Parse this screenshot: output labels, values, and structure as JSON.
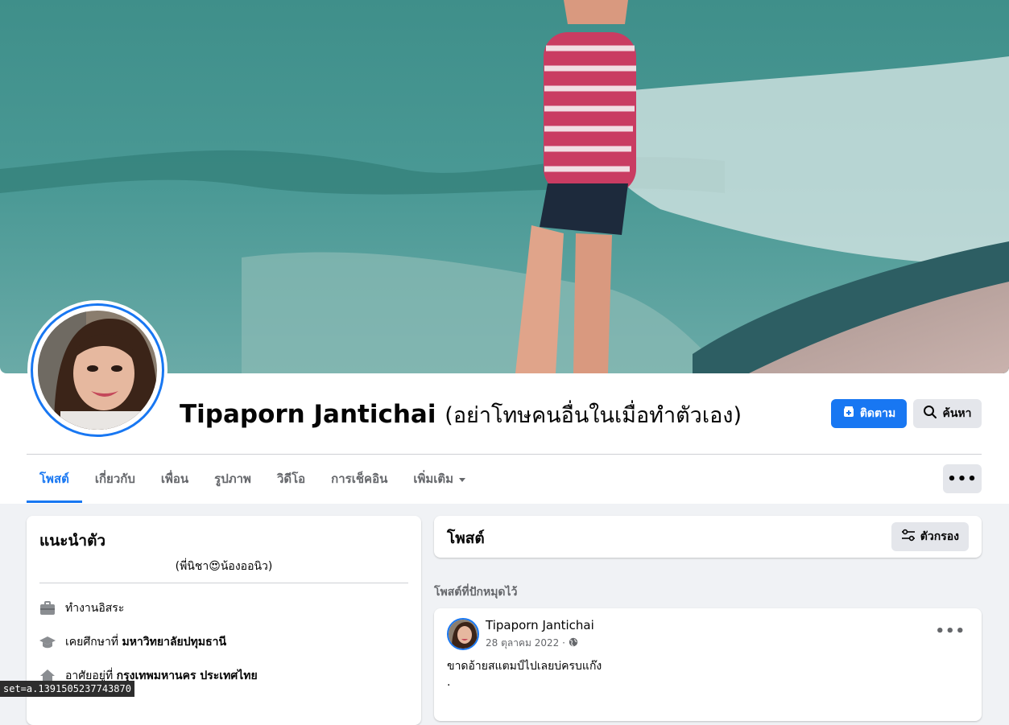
{
  "profile": {
    "name": "Tipaporn Jantichai",
    "alternate_name": "(อย่าโทษคนอื่นในเมื่อทำตัวเอง)"
  },
  "actions": {
    "follow_label": "ติดตาม",
    "search_label": "ค้นหา",
    "more_label": "•••"
  },
  "tabs": [
    {
      "label": "โพสต์"
    },
    {
      "label": "เกี่ยวกับ"
    },
    {
      "label": "เพื่อน"
    },
    {
      "label": "รูปภาพ"
    },
    {
      "label": "วิดีโอ"
    },
    {
      "label": "การเช็คอิน"
    },
    {
      "label": "เพิ่มเติม"
    }
  ],
  "intro": {
    "title": "แนะนำตัว",
    "bio_prefix": "(พี่นิชา",
    "bio_emoji": "😍",
    "bio_suffix": "น้องออนิว)",
    "rows": [
      {
        "icon": "briefcase-icon",
        "text": "ทำงานอิสระ",
        "bold": ""
      },
      {
        "icon": "graduation-cap-icon",
        "text": "เคยศึกษาที่ ",
        "bold": "มหาวิทยาลัยปทุมธานี"
      },
      {
        "icon": "home-icon",
        "text": "อาศัยอยู่ที่ ",
        "bold": "กรุงเทพมหานคร ประเทศไทย"
      }
    ]
  },
  "posts": {
    "title": "โพสต์",
    "filter_label": "ตัวกรอง",
    "pinned_label": "โพสต์ที่ปักหมุดไว้"
  },
  "post": {
    "author": "Tipaporn Jantichai",
    "date": "28 ตุลาคม 2022 ·",
    "text_line1": "ขาดอ้ายสแตมป์ไปเลยบ่ครบแก๊ง",
    "text_line2": ".",
    "more_label": "•••"
  },
  "status_bar": {
    "text": "set=a.1391505237743870"
  },
  "colors": {
    "accent": "#1877f2",
    "background": "#f0f2f5",
    "secondary_button": "#e4e6eb"
  }
}
